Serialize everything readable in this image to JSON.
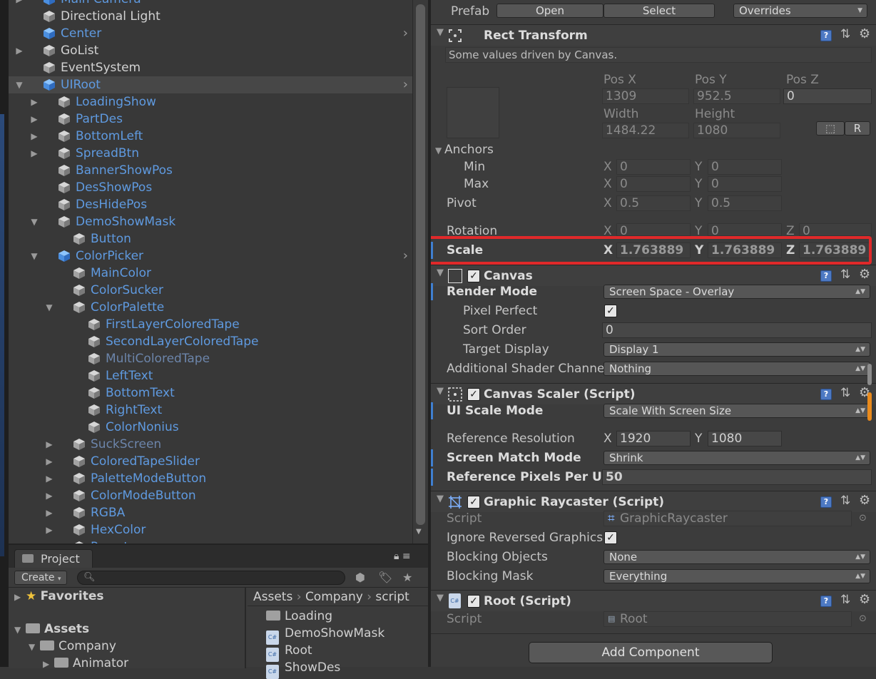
{
  "hierarchy": {
    "items": [
      {
        "label": "Main Camera",
        "color": "blue",
        "indent": 0,
        "arrow": true,
        "icon": "blue-cube"
      },
      {
        "label": "Directional Light",
        "color": "white",
        "indent": 0,
        "arrow": false,
        "icon": "cube"
      },
      {
        "label": "Center",
        "color": "blue",
        "indent": 0,
        "arrow": false,
        "icon": "blue-cube",
        "more": true
      },
      {
        "label": "GoList",
        "color": "white",
        "indent": 0,
        "arrow": "right",
        "icon": "cube"
      },
      {
        "label": "EventSystem",
        "color": "white",
        "indent": 0,
        "arrow": false,
        "icon": "cube"
      },
      {
        "label": "UIRoot",
        "color": "blue",
        "indent": 0,
        "arrow": "down",
        "icon": "blue-cube",
        "selected": true,
        "more": true
      },
      {
        "label": "LoadingShow",
        "color": "blue",
        "indent": 1,
        "arrow": "right",
        "icon": "cube"
      },
      {
        "label": "PartDes",
        "color": "blue",
        "indent": 1,
        "arrow": "right",
        "icon": "cube"
      },
      {
        "label": "BottomLeft",
        "color": "blue",
        "indent": 1,
        "arrow": "right",
        "icon": "cube"
      },
      {
        "label": "SpreadBtn",
        "color": "blue",
        "indent": 1,
        "arrow": "right",
        "icon": "cube"
      },
      {
        "label": "BannerShowPos",
        "color": "blue",
        "indent": 1,
        "arrow": false,
        "icon": "cube"
      },
      {
        "label": "DesShowPos",
        "color": "blue",
        "indent": 1,
        "arrow": false,
        "icon": "cube"
      },
      {
        "label": "DesHidePos",
        "color": "blue",
        "indent": 1,
        "arrow": false,
        "icon": "cube"
      },
      {
        "label": "DemoShowMask",
        "color": "blue",
        "indent": 1,
        "arrow": "down",
        "icon": "cube"
      },
      {
        "label": "Button",
        "color": "blue",
        "indent": 2,
        "arrow": false,
        "icon": "cube"
      },
      {
        "label": "ColorPicker",
        "color": "blue",
        "indent": 1,
        "arrow": "down",
        "icon": "blue-cube",
        "more": true
      },
      {
        "label": "MainColor",
        "color": "blue",
        "indent": 2,
        "arrow": false,
        "icon": "cube"
      },
      {
        "label": "ColorSucker",
        "color": "blue",
        "indent": 2,
        "arrow": false,
        "icon": "cube"
      },
      {
        "label": "ColorPalette",
        "color": "blue",
        "indent": 2,
        "arrow": "down",
        "icon": "cube"
      },
      {
        "label": "FirstLayerColoredTape",
        "color": "blue",
        "indent": 3,
        "arrow": false,
        "icon": "cube"
      },
      {
        "label": "SecondLayerColoredTape",
        "color": "blue",
        "indent": 3,
        "arrow": false,
        "icon": "cube"
      },
      {
        "label": "MultiColoredTape",
        "color": "dim",
        "indent": 3,
        "arrow": false,
        "icon": "cube"
      },
      {
        "label": "LeftText",
        "color": "blue",
        "indent": 3,
        "arrow": false,
        "icon": "cube"
      },
      {
        "label": "BottomText",
        "color": "blue",
        "indent": 3,
        "arrow": false,
        "icon": "cube"
      },
      {
        "label": "RightText",
        "color": "blue",
        "indent": 3,
        "arrow": false,
        "icon": "cube"
      },
      {
        "label": "ColorNonius",
        "color": "blue",
        "indent": 3,
        "arrow": false,
        "icon": "cube"
      },
      {
        "label": "SuckScreen",
        "color": "dim",
        "indent": 2,
        "arrow": "right",
        "icon": "cube"
      },
      {
        "label": "ColoredTapeSlider",
        "color": "blue",
        "indent": 2,
        "arrow": "right",
        "icon": "cube"
      },
      {
        "label": "PaletteModeButton",
        "color": "blue",
        "indent": 2,
        "arrow": "right",
        "icon": "cube"
      },
      {
        "label": "ColorModeButton",
        "color": "blue",
        "indent": 2,
        "arrow": "right",
        "icon": "cube"
      },
      {
        "label": "RGBA",
        "color": "blue",
        "indent": 2,
        "arrow": "right",
        "icon": "cube"
      },
      {
        "label": "HexColor",
        "color": "blue",
        "indent": 2,
        "arrow": "right",
        "icon": "cube"
      },
      {
        "label": "Preset",
        "color": "blue",
        "indent": 2,
        "arrow": "right",
        "icon": "cube"
      }
    ]
  },
  "project": {
    "tab_label": "Project",
    "create_label": "Create",
    "favorites_label": "Favorites",
    "assets_label": "Assets",
    "company_label": "Company",
    "animator_label": "Animator",
    "breadcrumb": [
      "Assets",
      "Company",
      "script"
    ],
    "files": [
      {
        "name": "Loading",
        "type": "folder"
      },
      {
        "name": "DemoShowMask",
        "type": "script"
      },
      {
        "name": "Root",
        "type": "script"
      },
      {
        "name": "ShowDes",
        "type": "script"
      }
    ]
  },
  "inspector": {
    "prefab": {
      "label": "Prefab",
      "open": "Open",
      "select": "Select",
      "overrides": "Overrides"
    },
    "rect_transform": {
      "title": "Rect Transform",
      "note": "Some values driven by Canvas.",
      "pos_x_label": "Pos X",
      "pos_y_label": "Pos Y",
      "pos_z_label": "Pos Z",
      "pos_x": "1309",
      "pos_y": "952.5",
      "pos_z": "0",
      "width_label": "Width",
      "height_label": "Height",
      "width": "1484.22",
      "height": "1080",
      "r_button": "R",
      "anchors_label": "Anchors",
      "min_label": "Min",
      "min_x": "0",
      "min_y": "0",
      "max_label": "Max",
      "max_x": "0",
      "max_y": "0",
      "pivot_label": "Pivot",
      "pivot_x": "0.5",
      "pivot_y": "0.5",
      "rotation_label": "Rotation",
      "rot_x": "0",
      "rot_y": "0",
      "rot_z": "0",
      "scale_label": "Scale",
      "scale_x": "1.763889",
      "scale_y": "1.763889",
      "scale_z": "1.763889",
      "axis_x": "X",
      "axis_y": "Y",
      "axis_z": "Z"
    },
    "canvas": {
      "title": "Canvas",
      "render_mode_label": "Render Mode",
      "render_mode": "Screen Space - Overlay",
      "pixel_perfect_label": "Pixel Perfect",
      "sort_order_label": "Sort Order",
      "sort_order": "0",
      "target_display_label": "Target Display",
      "target_display": "Display 1",
      "shader_channels_label": "Additional Shader Channe",
      "shader_channels": "Nothing"
    },
    "canvas_scaler": {
      "title": "Canvas Scaler (Script)",
      "ui_scale_mode_label": "UI Scale Mode",
      "ui_scale_mode": "Scale With Screen Size",
      "ref_res_label": "Reference Resolution",
      "ref_res_x": "1920",
      "ref_res_y": "1080",
      "match_mode_label": "Screen Match Mode",
      "match_mode": "Shrink",
      "ref_ppu_label": "Reference Pixels Per Ui",
      "ref_ppu": "50"
    },
    "graphic_raycaster": {
      "title": "Graphic Raycaster (Script)",
      "script_label": "Script",
      "script": "GraphicRaycaster",
      "ignore_label": "Ignore Reversed Graphics",
      "blocking_objects_label": "Blocking Objects",
      "blocking_objects": "None",
      "blocking_mask_label": "Blocking Mask",
      "blocking_mask": "Everything"
    },
    "root_script": {
      "title": "Root (Script)",
      "script_label": "Script",
      "script": "Root"
    },
    "add_component": "Add Component"
  },
  "colors": {
    "accent_blue": "#5f9ae0",
    "highlight_red": "#e0292a",
    "panel": "#383838"
  }
}
